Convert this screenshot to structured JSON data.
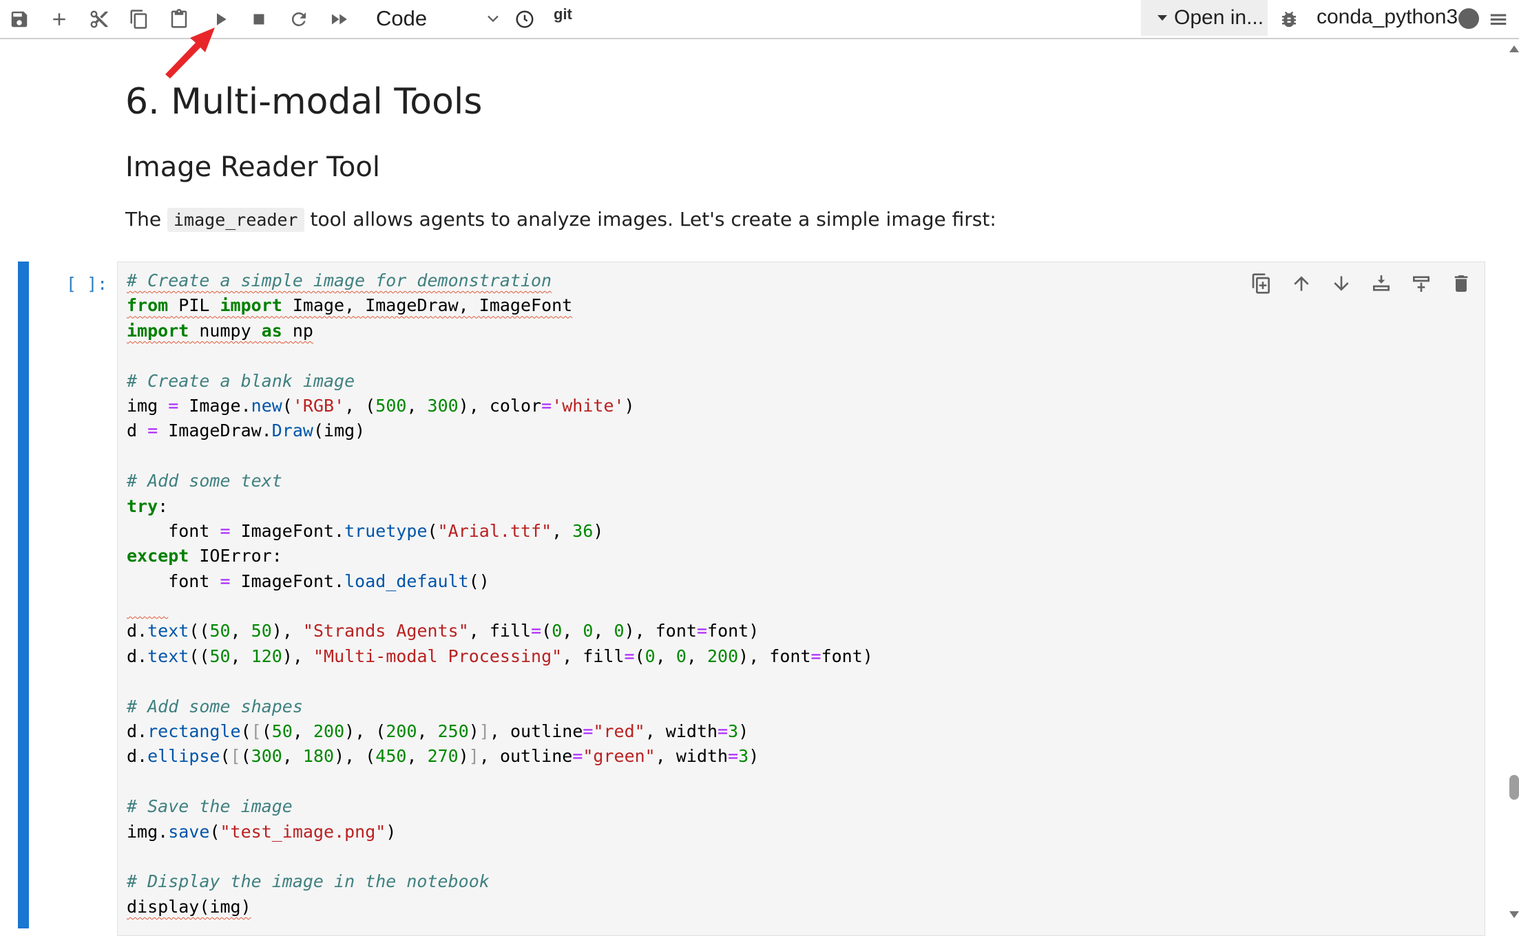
{
  "toolbar": {
    "cell_type": "Code",
    "git_label": "git",
    "open_in": "Open in...",
    "kernel_name": "conda_python3",
    "icons": [
      "save-icon",
      "add-icon",
      "cut-icon",
      "copy-icon",
      "paste-icon",
      "run-icon",
      "stop-icon",
      "restart-icon",
      "fast-forward-icon",
      "clock-icon",
      "bug-icon",
      "menu-icon"
    ]
  },
  "annotation": {
    "arrow_color": "#e8262a"
  },
  "markdown": {
    "h1": "6. Multi-modal Tools",
    "h2": "Image Reader Tool",
    "p_before": "The ",
    "p_code": "image_reader",
    "p_after": " tool allows agents to analyze images. Let's create a simple image first:"
  },
  "cell": {
    "prompt": "[ ]:",
    "lines": [
      [
        [
          "c",
          "# Create a simple image for demonstration"
        ]
      ],
      [
        [
          "k",
          "from"
        ],
        [
          "t",
          " PIL "
        ],
        [
          "k",
          "import"
        ],
        [
          "t",
          " Image, ImageDraw, ImageFont"
        ]
      ],
      [
        [
          "k",
          "import"
        ],
        [
          "t",
          " numpy "
        ],
        [
          "k",
          "as"
        ],
        [
          "t",
          " np"
        ]
      ],
      [],
      [
        [
          "c",
          "# Create a blank image"
        ]
      ],
      [
        [
          "t",
          "img "
        ],
        [
          "o",
          "="
        ],
        [
          "t",
          " Image."
        ],
        [
          "f",
          "new"
        ],
        [
          "t",
          "("
        ],
        [
          "s",
          "'RGB'"
        ],
        [
          "t",
          ", ("
        ],
        [
          "n",
          "500"
        ],
        [
          "t",
          ", "
        ],
        [
          "n",
          "300"
        ],
        [
          "t",
          "), color"
        ],
        [
          "o",
          "="
        ],
        [
          "s",
          "'white'"
        ],
        [
          "t",
          ")"
        ]
      ],
      [
        [
          "t",
          "d "
        ],
        [
          "o",
          "="
        ],
        [
          "t",
          " ImageDraw."
        ],
        [
          "f",
          "Draw"
        ],
        [
          "t",
          "(img)"
        ]
      ],
      [],
      [
        [
          "c",
          "# Add some text"
        ]
      ],
      [
        [
          "k",
          "try"
        ],
        [
          "t",
          ":"
        ]
      ],
      [
        [
          "t",
          "    font "
        ],
        [
          "o",
          "="
        ],
        [
          "t",
          " ImageFont."
        ],
        [
          "f",
          "truetype"
        ],
        [
          "t",
          "("
        ],
        [
          "s",
          "\"Arial.ttf\""
        ],
        [
          "t",
          ", "
        ],
        [
          "n",
          "36"
        ],
        [
          "t",
          ")"
        ]
      ],
      [
        [
          "k",
          "except"
        ],
        [
          "t",
          " IOError:"
        ]
      ],
      [
        [
          "t",
          "    font "
        ],
        [
          "o",
          "="
        ],
        [
          "t",
          " ImageFont."
        ],
        [
          "f",
          "load_default"
        ],
        [
          "t",
          "()"
        ]
      ],
      [
        [
          "t",
          "    "
        ]
      ],
      [
        [
          "t",
          "d."
        ],
        [
          "f",
          "text"
        ],
        [
          "t",
          "(("
        ],
        [
          "n",
          "50"
        ],
        [
          "t",
          ", "
        ],
        [
          "n",
          "50"
        ],
        [
          "t",
          "), "
        ],
        [
          "s",
          "\"Strands Agents\""
        ],
        [
          "t",
          ", fill"
        ],
        [
          "o",
          "="
        ],
        [
          "t",
          "("
        ],
        [
          "n",
          "0"
        ],
        [
          "t",
          ", "
        ],
        [
          "n",
          "0"
        ],
        [
          "t",
          ", "
        ],
        [
          "n",
          "0"
        ],
        [
          "t",
          "), font"
        ],
        [
          "o",
          "="
        ],
        [
          "t",
          "font)"
        ]
      ],
      [
        [
          "t",
          "d."
        ],
        [
          "f",
          "text"
        ],
        [
          "t",
          "(("
        ],
        [
          "n",
          "50"
        ],
        [
          "t",
          ", "
        ],
        [
          "n",
          "120"
        ],
        [
          "t",
          "), "
        ],
        [
          "s",
          "\"Multi-modal Processing\""
        ],
        [
          "t",
          ", fill"
        ],
        [
          "o",
          "="
        ],
        [
          "t",
          "("
        ],
        [
          "n",
          "0"
        ],
        [
          "t",
          ", "
        ],
        [
          "n",
          "0"
        ],
        [
          "t",
          ", "
        ],
        [
          "n",
          "200"
        ],
        [
          "t",
          "), font"
        ],
        [
          "o",
          "="
        ],
        [
          "t",
          "font)"
        ]
      ],
      [],
      [
        [
          "c",
          "# Add some shapes"
        ]
      ],
      [
        [
          "t",
          "d."
        ],
        [
          "f",
          "rectangle"
        ],
        [
          "t",
          "("
        ],
        [
          "b",
          "["
        ],
        [
          "t",
          "("
        ],
        [
          "n",
          "50"
        ],
        [
          "t",
          ", "
        ],
        [
          "n",
          "200"
        ],
        [
          "t",
          "), ("
        ],
        [
          "n",
          "200"
        ],
        [
          "t",
          ", "
        ],
        [
          "n",
          "250"
        ],
        [
          "t",
          ")"
        ],
        [
          "b",
          "]"
        ],
        [
          "t",
          ", outline"
        ],
        [
          "o",
          "="
        ],
        [
          "s",
          "\"red\""
        ],
        [
          "t",
          ", width"
        ],
        [
          "o",
          "="
        ],
        [
          "n",
          "3"
        ],
        [
          "t",
          ")"
        ]
      ],
      [
        [
          "t",
          "d."
        ],
        [
          "f",
          "ellipse"
        ],
        [
          "t",
          "("
        ],
        [
          "b",
          "["
        ],
        [
          "t",
          "("
        ],
        [
          "n",
          "300"
        ],
        [
          "t",
          ", "
        ],
        [
          "n",
          "180"
        ],
        [
          "t",
          "), ("
        ],
        [
          "n",
          "450"
        ],
        [
          "t",
          ", "
        ],
        [
          "n",
          "270"
        ],
        [
          "t",
          ")"
        ],
        [
          "b",
          "]"
        ],
        [
          "t",
          ", outline"
        ],
        [
          "o",
          "="
        ],
        [
          "s",
          "\"green\""
        ],
        [
          "t",
          ", width"
        ],
        [
          "o",
          "="
        ],
        [
          "n",
          "3"
        ],
        [
          "t",
          ")"
        ]
      ],
      [],
      [
        [
          "c",
          "# Save the image"
        ]
      ],
      [
        [
          "t",
          "img."
        ],
        [
          "f",
          "save"
        ],
        [
          "t",
          "("
        ],
        [
          "s",
          "\"test_image.png\""
        ],
        [
          "t",
          ")"
        ]
      ],
      [],
      [
        [
          "c",
          "# Display the image in the notebook"
        ]
      ],
      [
        [
          "t",
          "display(img)"
        ]
      ]
    ],
    "squiggle_lines": [
      0,
      1,
      2,
      13,
      25
    ],
    "tools": [
      "duplicate-cell-icon",
      "move-up-icon",
      "move-down-icon",
      "insert-above-icon",
      "insert-below-icon",
      "delete-cell-icon"
    ]
  }
}
